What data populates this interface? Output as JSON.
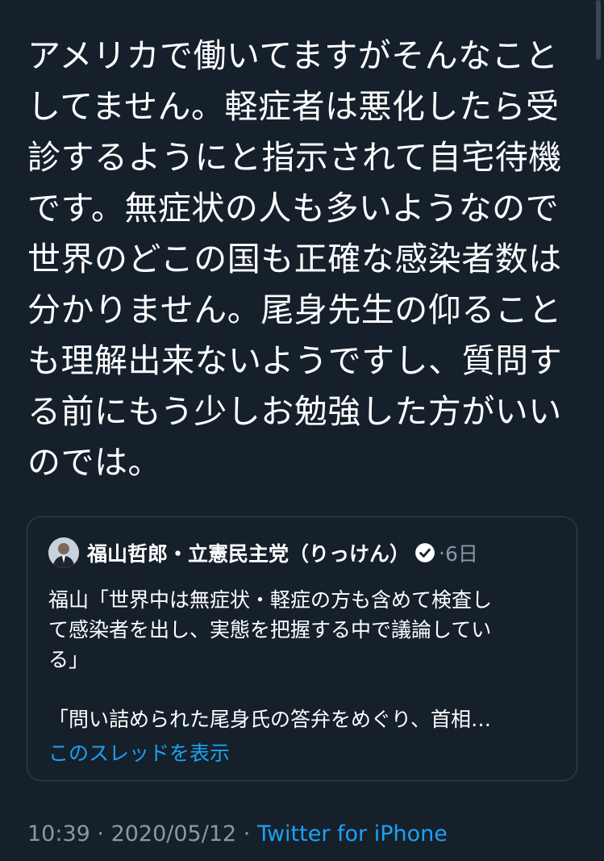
{
  "tweet": {
    "text_lines": [
      "アメリカで働いてますがそんなこと",
      "してません。軽症者は悪化したら受",
      "診するようにと指示されて自宅待機",
      "です。無症状の人も多いようなので",
      "世界のどこの国も正確な感染者数は",
      "分かりません。尾身先生の仰ること",
      "も理解出来ないようですし、質問す",
      "る前にもう少しお勉強した方がいい",
      "のでは。"
    ]
  },
  "quote": {
    "author_name": "福山哲郎・立憲民主党（りっけん）",
    "verified_icon": "verified-badge-icon",
    "separator": "·",
    "date": "6日",
    "body_lines": [
      "福山「世界中は無症状・軽症の方も含めて検査し",
      "て感染者を出し、実態を把握する中で議論してい",
      "る」"
    ],
    "body_lines_2": [
      "「問い詰められた尾身氏の答弁をめぐり、首相…"
    ],
    "thread_link": "このスレッドを表示"
  },
  "footer": {
    "time": "10:39",
    "sep1": " · ",
    "date": "2020/05/12",
    "sep2": " · ",
    "source": "Twitter for iPhone"
  },
  "colors": {
    "background": "#15202b",
    "text": "#ffffff",
    "secondary": "#8899a6",
    "link": "#1da1f2",
    "border": "#38444d"
  }
}
